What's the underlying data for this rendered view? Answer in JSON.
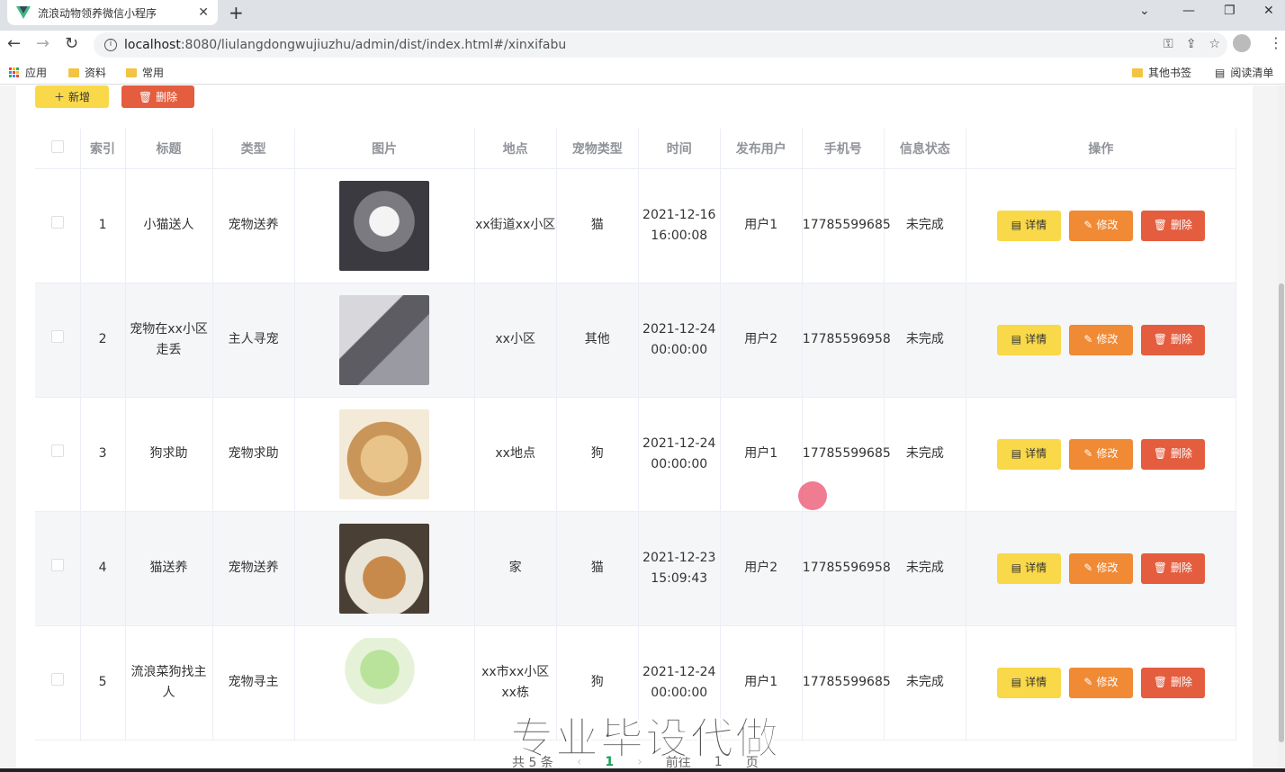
{
  "browser": {
    "tab_title": "流浪动物领养微信小程序",
    "url_host": "localhost",
    "url_rest": ":8080/liulangdongwujiuzhu/admin/dist/index.html#/xinxifabu",
    "bookmarks": [
      "应用",
      "资料",
      "常用"
    ],
    "bookmarks_right": [
      "其他书签",
      "阅读清单"
    ]
  },
  "toolbar": {
    "add_label": "新增",
    "delete_label": "删除"
  },
  "table": {
    "headers": [
      "索引",
      "标题",
      "类型",
      "图片",
      "地点",
      "宠物类型",
      "时间",
      "发布用户",
      "手机号",
      "信息状态",
      "操作"
    ],
    "rows": [
      {
        "index": "1",
        "title": "小猫送人",
        "type": "宠物送养",
        "place": "xx街道xx小区",
        "pet": "猫",
        "time": "2021-12-16 16:00:08",
        "user": "用户1",
        "phone": "17785599685",
        "status": "未完成",
        "image": "cat-gray"
      },
      {
        "index": "2",
        "title": "宠物在xx小区走丢",
        "type": "主人寻宠",
        "place": "xx小区",
        "pet": "其他",
        "time": "2021-12-24 00:00:00",
        "user": "用户2",
        "phone": "17785596958",
        "status": "未完成",
        "image": "wolf"
      },
      {
        "index": "3",
        "title": "狗求助",
        "type": "宠物求助",
        "place": "xx地点",
        "pet": "狗",
        "time": "2021-12-24 00:00:00",
        "user": "用户1",
        "phone": "17785599685",
        "status": "未完成",
        "image": "puppy"
      },
      {
        "index": "4",
        "title": "猫送养",
        "type": "宠物送养",
        "place": "家",
        "pet": "猫",
        "time": "2021-12-23 15:09:43",
        "user": "用户2",
        "phone": "17785596958",
        "status": "未完成",
        "image": "cat-hat"
      },
      {
        "index": "5",
        "title": "流浪菜狗找主人",
        "type": "宠物寻主",
        "place": "xx市xx小区xx栋",
        "pet": "狗",
        "time": "2021-12-24 00:00:00",
        "user": "用户1",
        "phone": "17785599685",
        "status": "未完成",
        "image": "cabbage-dog"
      }
    ],
    "row_actions": {
      "detail": "详情",
      "edit": "修改",
      "delete": "删除"
    }
  },
  "pager": {
    "total": "共 5 条",
    "current": "1",
    "goto": "前往",
    "page_input": "1",
    "page_suffix": "页"
  },
  "watermark": "专业毕设代做",
  "colors": {
    "yellow": "#f9d84a",
    "orange": "#f08a35",
    "red": "#e45d3e",
    "green": "#19a15a"
  }
}
